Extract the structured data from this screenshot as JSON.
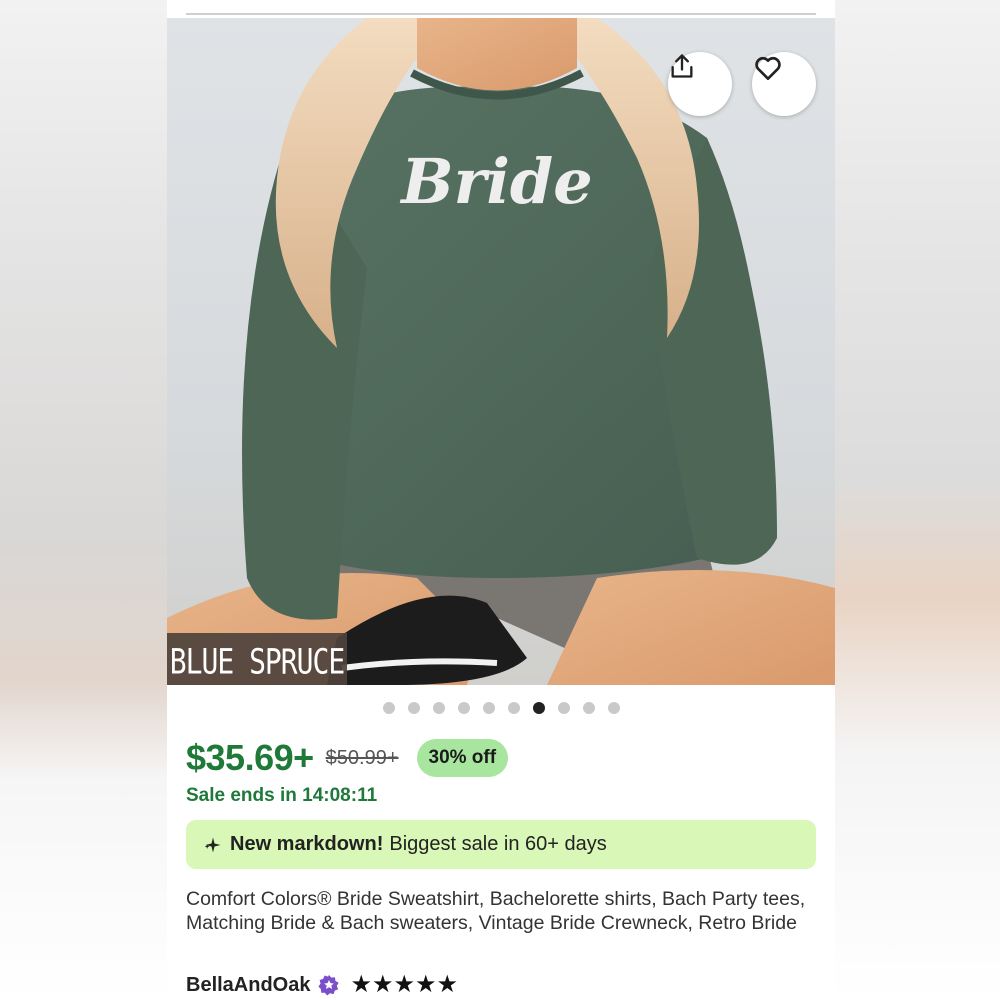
{
  "listing": {
    "color_label": "BLUE SPRUCE",
    "shirt_text": "Bride",
    "image_count": 10,
    "active_image_index": 6,
    "price": "$35.69+",
    "original_price": "$50.99+",
    "discount": "30% off",
    "sale_ends": "Sale ends in 14:08:11",
    "markdown_bold": "New markdown!",
    "markdown_text": "Biggest sale in 60+ days",
    "title": "Comfort Colors® Bride Sweatshirt, Bachelorette shirts, Bach Party tees, Matching Bride & Bach sweaters, Vintage Bride Crewneck, Retro Bride",
    "shop_name": "BellaAndOak",
    "rating_stars": "★★★★★",
    "rating": 5
  },
  "icons": {
    "share": "share-icon",
    "favorite": "heart-icon",
    "markdown": "sparkle-icon",
    "star_seller": "star-seller-badge-icon"
  },
  "colors": {
    "price_green": "#1f7a3a",
    "discount_bg": "#a8e6a0",
    "markdown_bg": "#d9f7b6",
    "sweater": "#4f6a5b",
    "badge_purple": "#7b4fc9"
  }
}
